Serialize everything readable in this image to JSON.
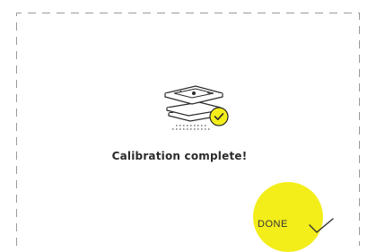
{
  "screen": {
    "message": "Calibration complete!",
    "done_label": "DONE",
    "accent_color": "#f3ee1a",
    "illustration_icon": "calibration-plate-stack-check-icon",
    "done_icon": "checkmark-icon"
  }
}
